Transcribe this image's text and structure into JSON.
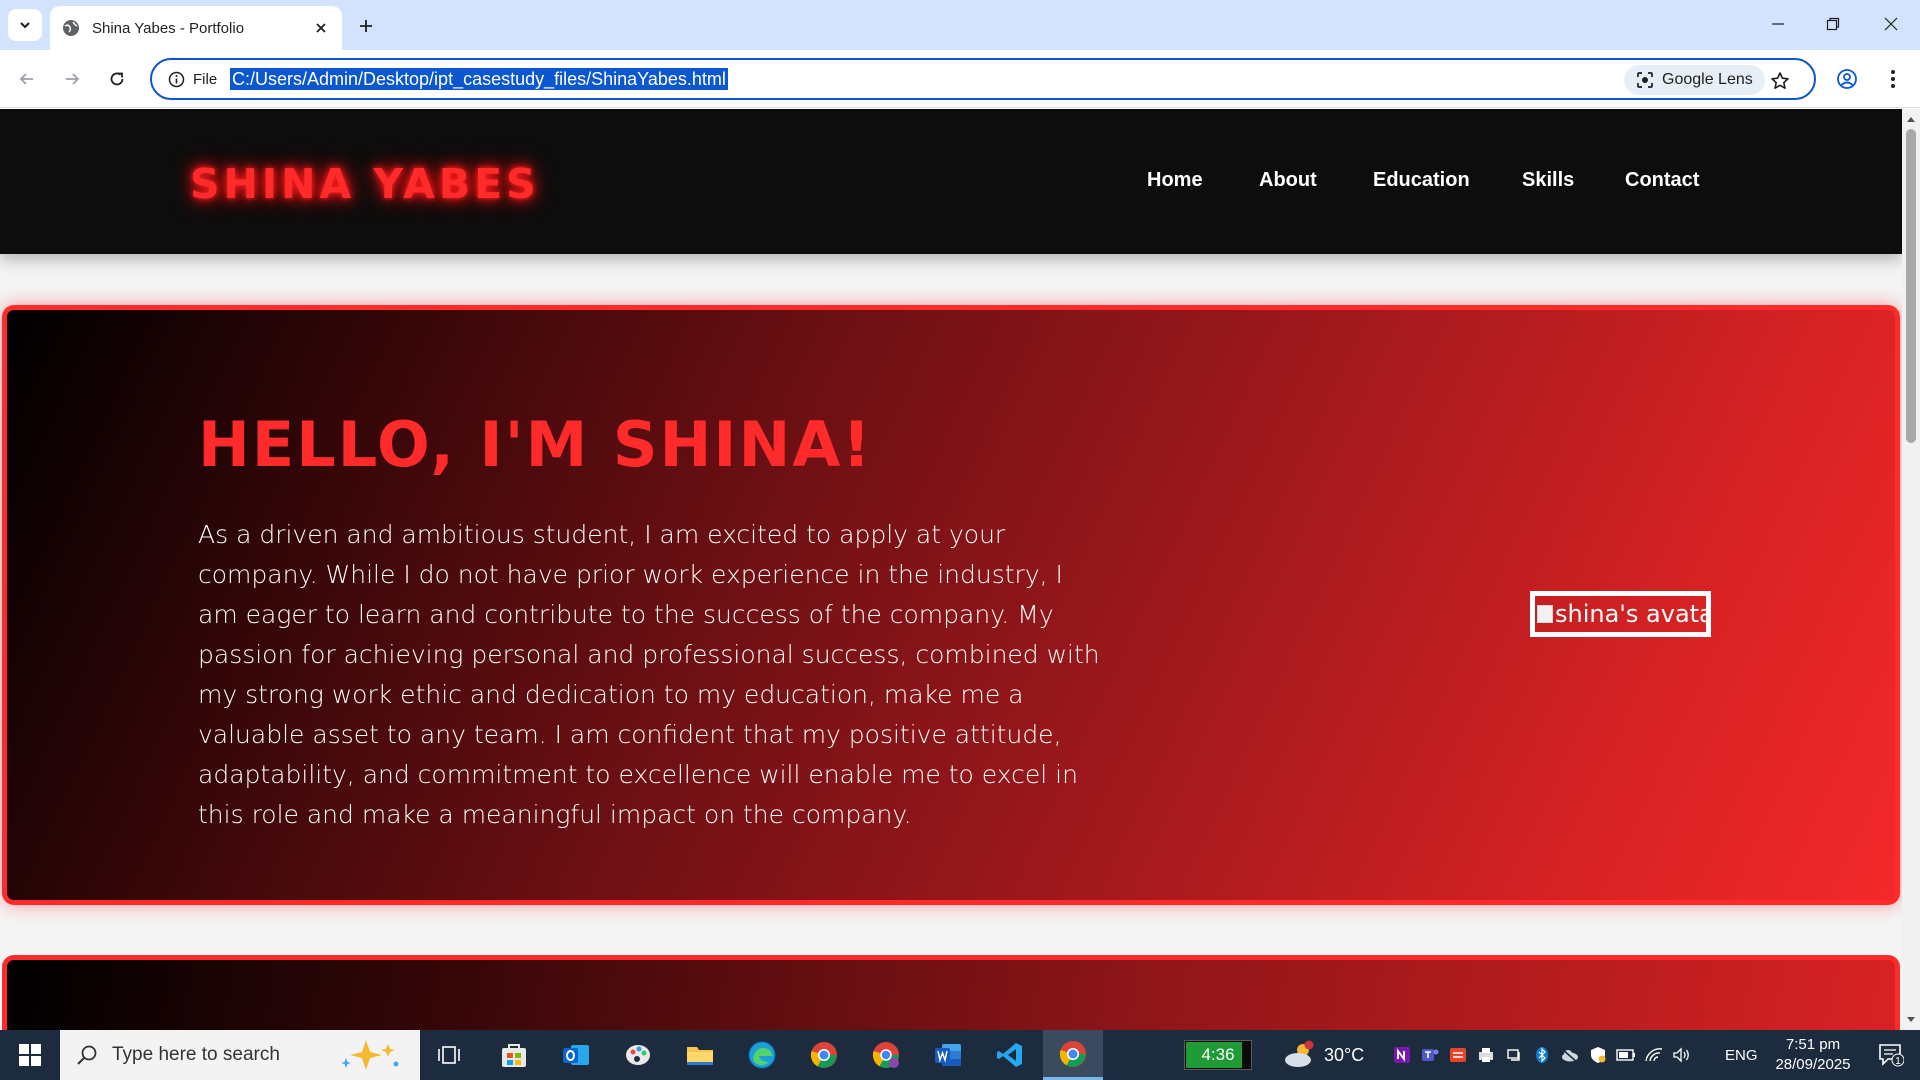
{
  "browser": {
    "tab_title": "Shina Yabes - Portfolio",
    "site_info_label": "File",
    "url": "C:/Users/Admin/Desktop/ipt_casestudy_files/ShinaYabes.html",
    "lens_label": "Google Lens"
  },
  "site": {
    "logo": "SHINA YABES",
    "nav": [
      "Home",
      "About",
      "Education",
      "Skills",
      "Contact"
    ],
    "hero_title": "HELLO, I'M SHINA!",
    "hero_text": "As a driven and ambitious student, I am excited to apply at your company. While I do not have prior work experience in the industry, I am eager to learn and contribute to the success of the company. My passion for achieving personal and professional success, combined with my strong work ethic and dedication to my education, make me a valuable asset to any team. I am confident that my positive attitude, adaptability, and commitment to excellence will enable me to excel in this role and make a meaningful impact on the company.",
    "avatar_alt": "shina's avatar",
    "accent_color": "#ff2b2b"
  },
  "taskbar": {
    "search_placeholder": "Type here to search",
    "battery_time": "4:36",
    "weather_temp": "30°C",
    "weather_badge": "3",
    "language": "ENG",
    "time": "7:51 pm",
    "date": "28/09/2025",
    "notification_count": "1"
  }
}
